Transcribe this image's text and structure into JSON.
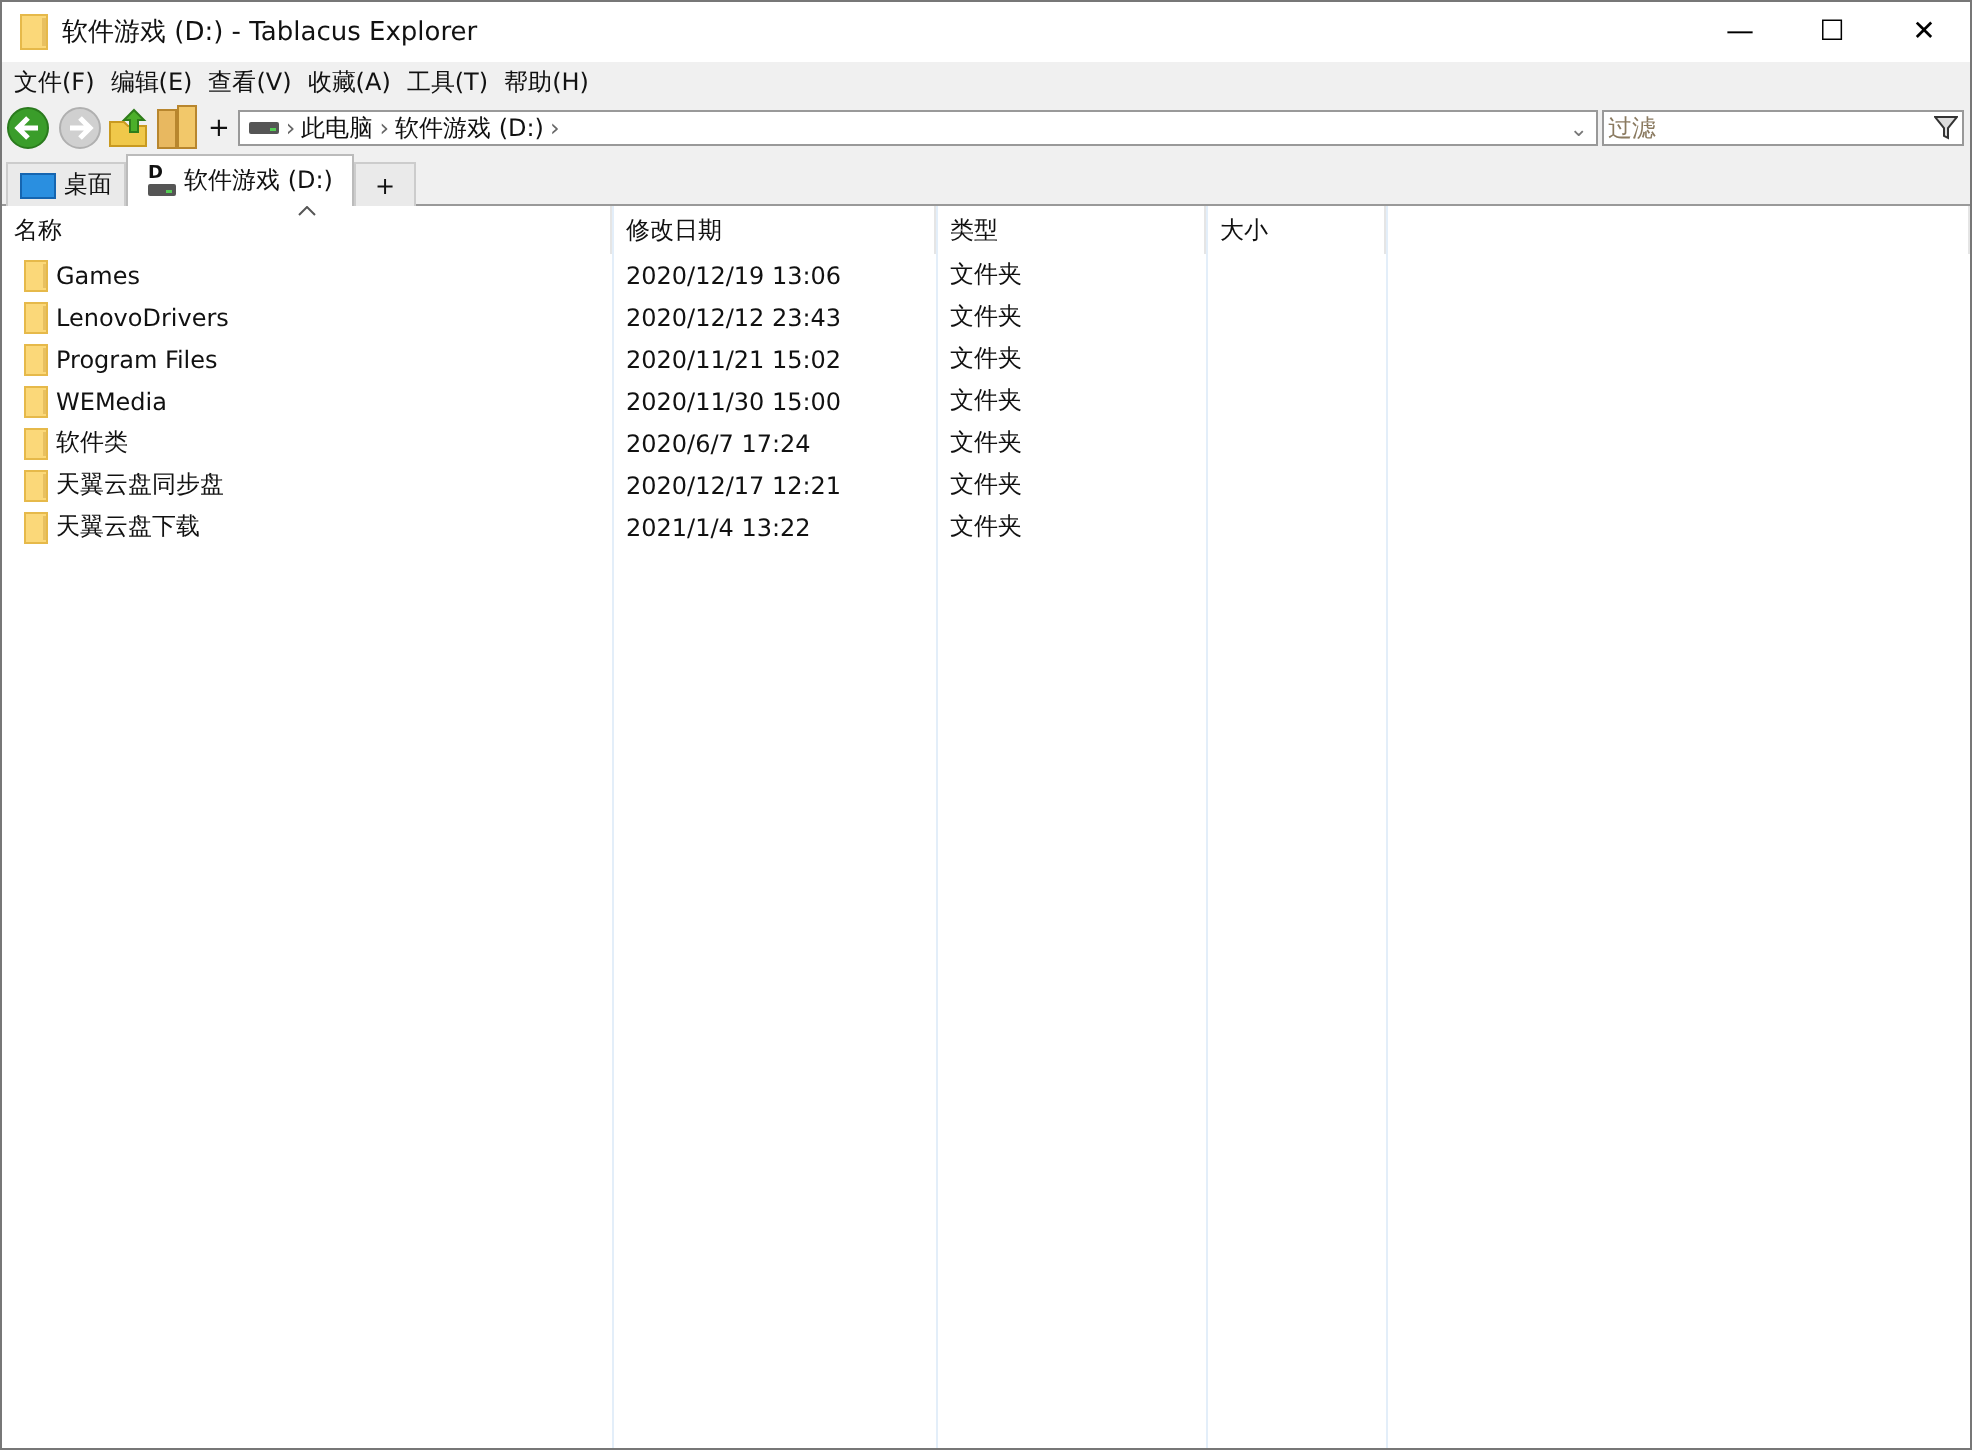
{
  "window": {
    "title": "软件游戏 (D:) - Tablacus Explorer",
    "controls": [
      "—",
      "☐",
      "✕"
    ]
  },
  "menu": [
    "文件(F)",
    "编辑(E)",
    "查看(V)",
    "收藏(A)",
    "工具(T)",
    "帮助(H)"
  ],
  "toolbar": {
    "back_disabled": false,
    "forward_disabled": true,
    "add": "+"
  },
  "address": {
    "crumbs": [
      {
        "label": "此电脑",
        "sep_before": "›"
      },
      {
        "label": "软件游戏 (D:)",
        "sep_before": "›"
      }
    ],
    "trailing_sep": "›",
    "dropdown": "⌄"
  },
  "filter": {
    "placeholder": "过滤"
  },
  "tabs": [
    {
      "label": "桌面",
      "kind": "desktop",
      "selected": false
    },
    {
      "label": "软件游戏 (D:)",
      "kind": "drive",
      "drive_letter": "D",
      "selected": true
    }
  ],
  "new_tab": "+",
  "table": {
    "columns": [
      {
        "label": "名称",
        "sorted": true
      },
      {
        "label": "修改日期",
        "sorted": false
      },
      {
        "label": "类型",
        "sorted": false
      },
      {
        "label": "大小",
        "sorted": false
      }
    ],
    "rows": [
      {
        "name": "Games",
        "date": "2020/12/19 13:06",
        "type": "文件夹"
      },
      {
        "name": "LenovoDrivers",
        "date": "2020/12/12 23:43",
        "type": "文件夹"
      },
      {
        "name": "Program Files",
        "date": "2020/11/21 15:02",
        "type": "文件夹"
      },
      {
        "name": "WEMedia",
        "date": "2020/11/30 15:00",
        "type": "文件夹"
      },
      {
        "name": "软件类",
        "date": "2020/6/7 17:24",
        "type": "文件夹"
      },
      {
        "name": "天翼云盘同步盘",
        "date": "2020/12/17 12:21",
        "type": "文件夹"
      },
      {
        "name": "天翼云盘下载",
        "date": "2021/1/4 13:22",
        "type": "文件夹"
      }
    ]
  }
}
